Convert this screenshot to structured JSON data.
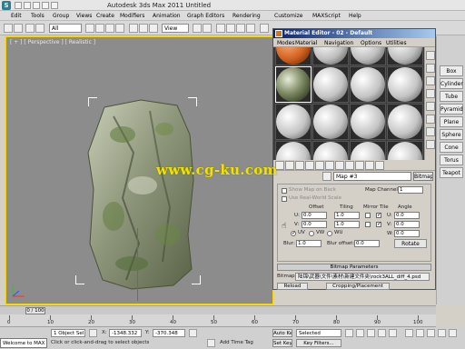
{
  "app": {
    "title": "Autodesk 3ds Max  2011      Untitled",
    "logo_letter": "S"
  },
  "menu": [
    "Edit",
    "Tools",
    "Group",
    "Views",
    "Create",
    "Modifiers",
    "Animation",
    "Graph Editors",
    "Rendering",
    "Customize",
    "MAXScript",
    "Help"
  ],
  "toolbar": {
    "selection_filter": "All",
    "ref_coord": "View"
  },
  "viewport": {
    "label": "[ + ] [ Perspective ] [ Realistic ]",
    "accent": "#f5d400"
  },
  "watermark": "www.cg-ku.com",
  "right_panel": {
    "buttons": [
      "Box",
      "Cylinder",
      "Tube",
      "Pyramid",
      "Plane",
      "Sphere",
      "Cone",
      "Torus",
      "Teapot"
    ]
  },
  "material_editor": {
    "title": "Material Editor - 02 - Default",
    "menu": [
      "Modes",
      "Material",
      "Navigation",
      "Options",
      "Utilities"
    ],
    "map_name": "Map #3",
    "map_type": "Bitmap",
    "params": {
      "show_map_on_back": "Show Map on Back",
      "use_real_world": "Use Real-World Scale",
      "map_channel_label": "Map Channel:",
      "map_channel": "1",
      "offset_label": "Offset",
      "tiling_label": "Tiling",
      "mirror_tile_label": "Mirror Tile",
      "angle_label": "Angle",
      "u_label": "U:",
      "v_label": "V:",
      "w_label": "W:",
      "u_offset": "0.0",
      "v_offset": "0.0",
      "u_tiling": "1.0",
      "v_tiling": "1.0",
      "u_angle": "0.0",
      "v_angle": "0.0",
      "w_angle": "0.0",
      "uv_label": "UV",
      "vw_label": "VW",
      "wu_label": "WU",
      "blur_label": "Blur:",
      "blur": "1.0",
      "blur_offset_label": "Blur offset:",
      "blur_offset": "0.0",
      "rotate": "Rotate"
    },
    "rollout": "Bitmap Parameters",
    "bitmap_label": "Bitmap:",
    "bitmap_path": "陆锦\\武器\\文件\\素材\\新建文件夹\\rock3ALL_diff_4.psd",
    "reload": "Reload",
    "cropping": "Cropping/Placement"
  },
  "timeline": {
    "frame_label": "0 / 100",
    "ticks": [
      "0",
      "10",
      "20",
      "30",
      "40",
      "50",
      "60",
      "70",
      "80",
      "90",
      "100"
    ]
  },
  "status": {
    "listener": "Welcome to MAX",
    "selection": "1 Object Sel",
    "x_label": "X:",
    "x_value": "-1348.332",
    "y_label": "Y:",
    "y_value": "-370.348",
    "hint": "Click or click-and-drag to select objects",
    "add_time_tag": "Add Time Tag",
    "auto_key": "Auto Key",
    "selected": "Selected",
    "set_key": "Set Key",
    "key_filters": "Key Filters..."
  }
}
